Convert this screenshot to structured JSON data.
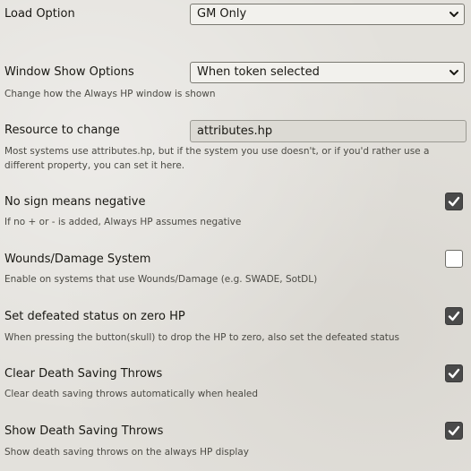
{
  "settings": {
    "load_option": {
      "label": "Load Option",
      "value": "GM Only"
    },
    "window_show": {
      "label": "Window Show Options",
      "value": "When token selected",
      "hint": "Change how the Always HP window is shown"
    },
    "resource": {
      "label": "Resource to change",
      "value": "attributes.hp",
      "hint": "Most systems use attributes.hp, but if the system you use doesn't, or if you'd rather use a different property, you can set it here."
    },
    "no_sign_negative": {
      "label": "No sign means negative",
      "hint": "If no + or - is added, Always HP assumes negative",
      "checked": true
    },
    "wounds_damage": {
      "label": "Wounds/Damage System",
      "hint": "Enable on systems that use Wounds/Damage (e.g. SWADE, SotDL)",
      "checked": false
    },
    "defeated_status": {
      "label": "Set defeated status on zero HP",
      "hint": "When pressing the button(skull) to drop the HP to zero, also set the defeated status",
      "checked": true
    },
    "clear_death_saves": {
      "label": "Clear Death Saving Throws",
      "hint": "Clear death saving throws automatically when healed",
      "checked": true
    },
    "show_death_saves": {
      "label": "Show Death Saving Throws",
      "hint": "Show death saving throws on the always HP display",
      "checked": true
    }
  },
  "icons": {
    "dropdown": "chevron-down-icon",
    "checkbox_checked": "check-icon"
  }
}
